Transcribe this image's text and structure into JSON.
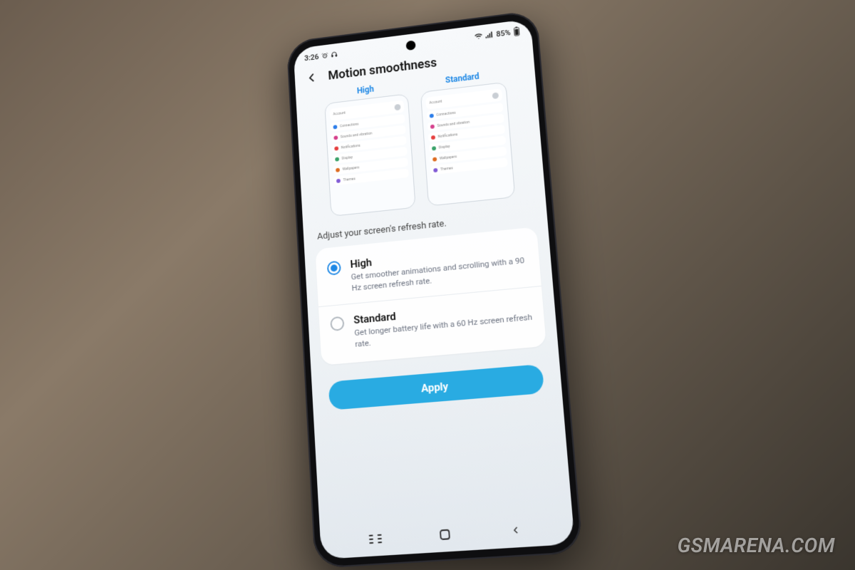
{
  "status": {
    "time": "3:26",
    "left_icons": [
      "alarm-icon",
      "headphones-icon"
    ],
    "wifi": true,
    "signal": true,
    "battery_percent": "85%"
  },
  "header": {
    "title": "Motion smoothness"
  },
  "previews": [
    {
      "label": "High",
      "items": [
        {
          "color": "#2b7de9",
          "text": "Connections"
        },
        {
          "color": "#d53f8c",
          "text": "Sounds and vibration"
        },
        {
          "color": "#e53e3e",
          "text": "Notifications"
        },
        {
          "color": "#38a169",
          "text": "Display"
        },
        {
          "color": "#dd6b20",
          "text": "Wallpapers"
        },
        {
          "color": "#805ad5",
          "text": "Themes"
        }
      ],
      "account_label": "Account"
    },
    {
      "label": "Standard",
      "items": [
        {
          "color": "#2b7de9",
          "text": "Connections"
        },
        {
          "color": "#d53f8c",
          "text": "Sounds and vibration"
        },
        {
          "color": "#e53e3e",
          "text": "Notifications"
        },
        {
          "color": "#38a169",
          "text": "Display"
        },
        {
          "color": "#dd6b20",
          "text": "Wallpapers"
        },
        {
          "color": "#805ad5",
          "text": "Themes"
        }
      ],
      "account_label": "Account"
    }
  ],
  "description": "Adjust your screen's refresh rate.",
  "options": [
    {
      "id": "high",
      "title": "High",
      "subtitle": "Get smoother animations and scrolling with a 90 Hz screen refresh rate.",
      "selected": true
    },
    {
      "id": "standard",
      "title": "Standard",
      "subtitle": "Get longer battery life with a 60 Hz screen refresh rate.",
      "selected": false
    }
  ],
  "apply_label": "Apply",
  "watermark": "GSMARENA.COM",
  "colors": {
    "accent": "#1e88e5",
    "apply": "#29abe2"
  }
}
